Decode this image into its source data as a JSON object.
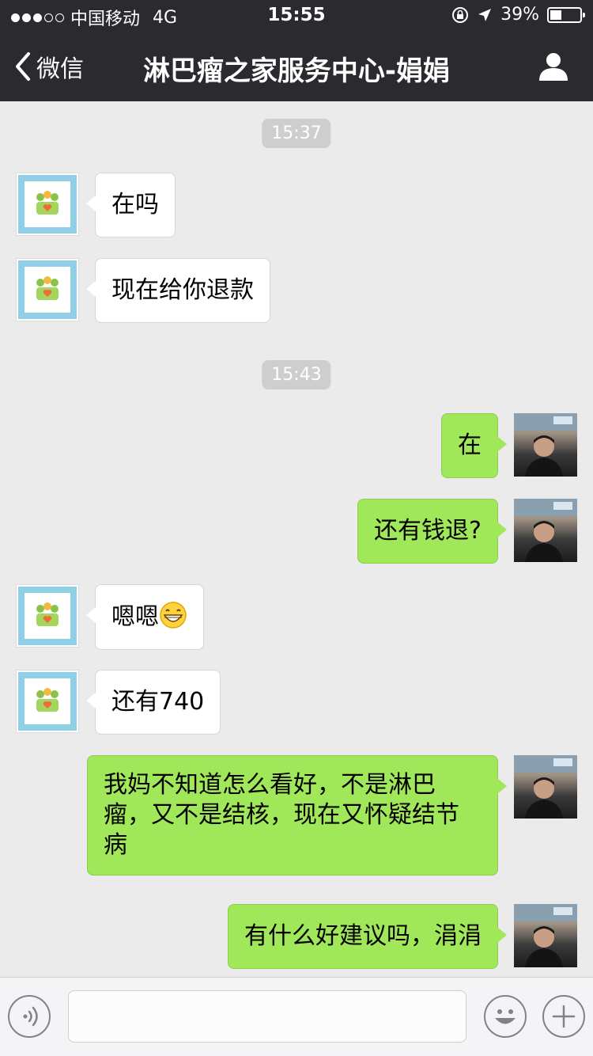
{
  "status_bar": {
    "carrier": "中国移动",
    "network": "4G",
    "time": "15:55",
    "battery": "39%",
    "battery_level": 0.39
  },
  "nav": {
    "back_label": "微信",
    "title": "淋巴瘤之家服务中心-娟娟"
  },
  "chat": {
    "timestamps": [
      "15:37",
      "15:43"
    ],
    "messages": [
      {
        "from": "them",
        "text": "在吗"
      },
      {
        "from": "them",
        "text": "现在给你退款"
      },
      {
        "from": "me",
        "text": "在"
      },
      {
        "from": "me",
        "text": "还有钱退?"
      },
      {
        "from": "them",
        "text": "嗯嗯"
      },
      {
        "from": "them",
        "text": "还有740"
      },
      {
        "from": "me",
        "text": "我妈不知道怎么看好，不是淋巴瘤，又不是结核，现在又怀疑结节病"
      },
      {
        "from": "me",
        "text": "有什么好建议吗，涓涓"
      }
    ]
  },
  "input_bar": {
    "placeholder": "",
    "voice_icon": "voice-icon",
    "emoji_icon": "emoji-icon",
    "plus_icon": "plus-icon"
  },
  "colors": {
    "nav_bg": "#2b2b2f",
    "chat_bg": "#ebebeb",
    "out_bubble": "#a0e75a",
    "in_bubble": "#ffffff"
  }
}
